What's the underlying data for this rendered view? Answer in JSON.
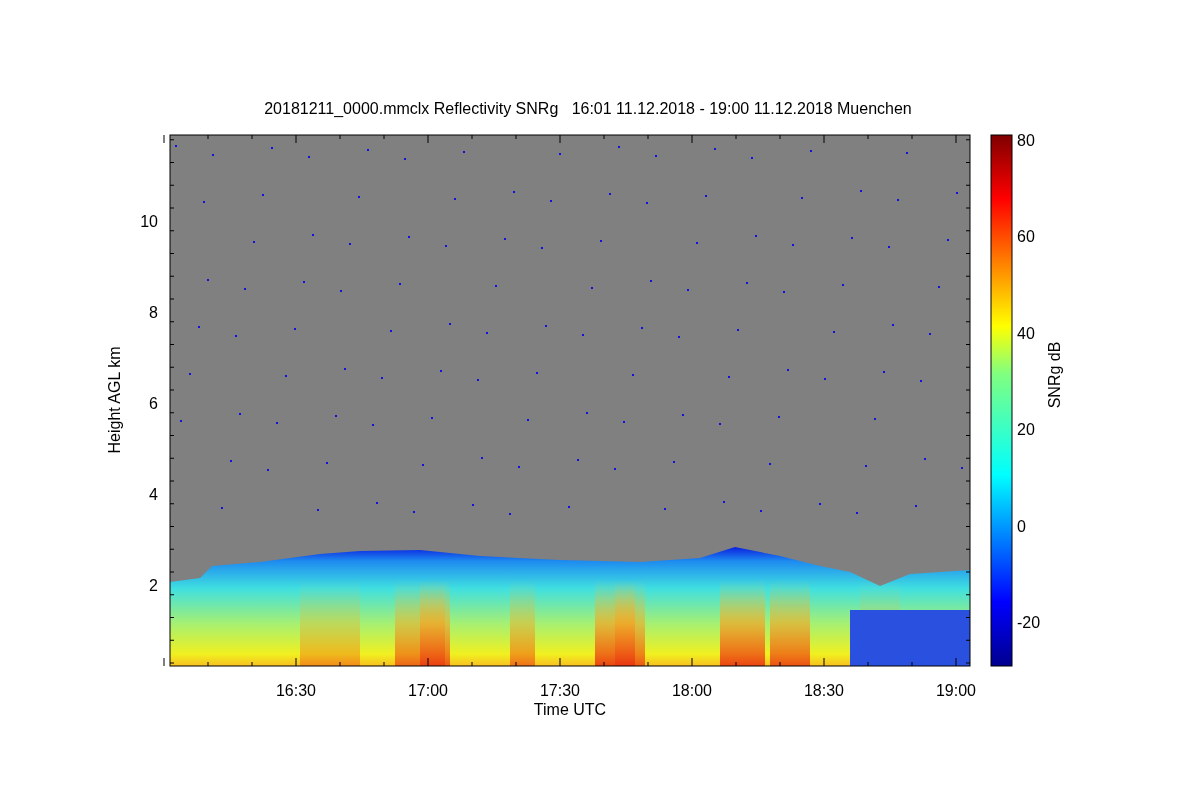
{
  "title": "20181211_0000.mmclx Reflectivity SNRg   16:01 11.12.2018 - 19:00 11.12.2018 Muenchen",
  "y_axis": {
    "label": "Height AGL km",
    "ticks": [
      "10",
      "8",
      "6",
      "4",
      "2"
    ]
  },
  "x_axis": {
    "label": "Time UTC",
    "ticks": [
      "16:30",
      "17:00",
      "17:30",
      "18:00",
      "18:30",
      "19:00"
    ]
  },
  "colorbar": {
    "label": "SNRg dB",
    "ticks": [
      "80",
      "60",
      "40",
      "20",
      "0",
      "-20"
    ]
  }
}
